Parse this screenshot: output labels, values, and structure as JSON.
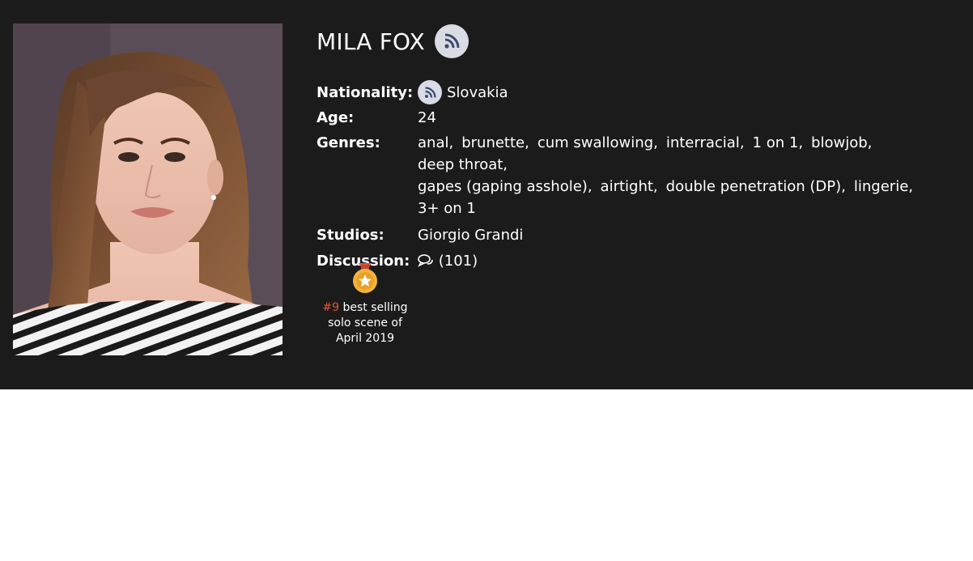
{
  "profile": {
    "name": "MILA FOX",
    "labels": {
      "nationality": "Nationality:",
      "age": "Age:",
      "genres": "Genres:",
      "studios": "Studios:",
      "discussion": "Discussion:"
    },
    "nationality": "Slovakia",
    "age": "24",
    "genres": [
      "anal,",
      "brunette,",
      "cum swallowing,",
      "interracial,",
      "1 on 1,",
      "blowjob,",
      "deep throat,",
      "gapes (gaping asshole),",
      "airtight,",
      "double penetration (DP),",
      "lingerie,",
      "3+ on 1"
    ],
    "studio": "Giorgio Grandi",
    "discussion_count": "(101)"
  },
  "award": {
    "rank": "#9",
    "text1": " best selling",
    "text2": "solo scene of",
    "text3": "April 2019"
  },
  "icons": {
    "rss": "rss-icon",
    "comments": "comments-icon",
    "medal": "medal-icon"
  },
  "colors": {
    "banner_bg": "#1b1b1b",
    "rss_bg": "#d9dce5",
    "rss_fg": "#3d4a6b",
    "rank": "#e05533"
  }
}
